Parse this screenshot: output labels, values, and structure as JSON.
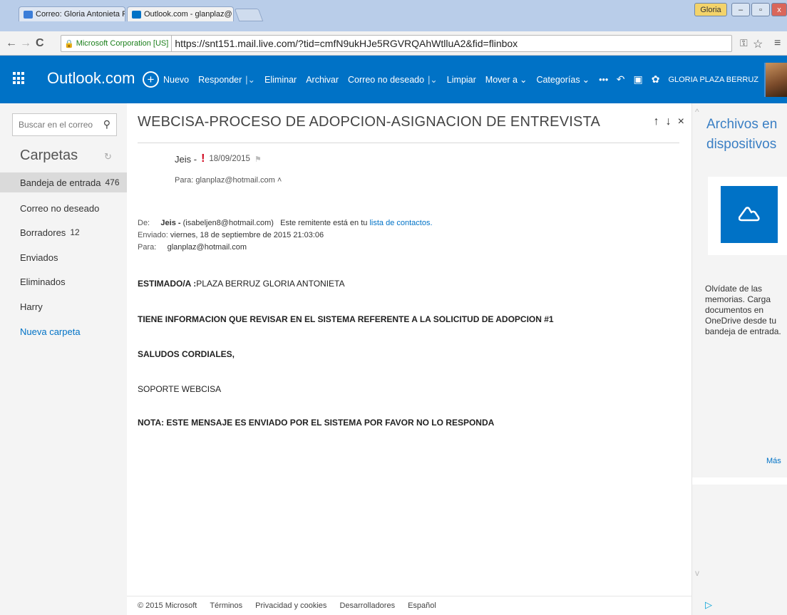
{
  "browser": {
    "tabs": [
      {
        "title": "Correo: Gloria Antonieta P"
      },
      {
        "title": "Outlook.com - glanplaz@"
      }
    ],
    "profile": "Gloria",
    "secure_label": "Microsoft Corporation [US]",
    "url": "https://snt151.mail.live.com/?tid=cmfN9ukHJe5RGVRQAhWtlluA2&fid=flinbox"
  },
  "header": {
    "brand": "Outlook.com",
    "commands": {
      "new": "Nuevo",
      "reply": "Responder",
      "delete": "Eliminar",
      "archive": "Archivar",
      "junk": "Correo no deseado",
      "sweep": "Limpiar",
      "move": "Mover a",
      "categories": "Categorías",
      "more": "•••"
    },
    "user": "GLORIA PLAZA BERRUZ"
  },
  "sidebar": {
    "search_placeholder": "Buscar en el correo",
    "folders_title": "Carpetas",
    "folders": [
      {
        "label": "Bandeja de entrada",
        "count": "476"
      },
      {
        "label": "Correo no deseado",
        "count": ""
      },
      {
        "label": "Borradores",
        "count": "12"
      },
      {
        "label": "Enviados",
        "count": ""
      },
      {
        "label": "Eliminados",
        "count": ""
      },
      {
        "label": "Harry",
        "count": ""
      }
    ],
    "new_folder": "Nueva carpeta"
  },
  "message": {
    "subject": "WEBCISA-PROCESO DE ADOPCION-ASIGNACION DE ENTREVISTA",
    "sender": "Jeis -",
    "date": "18/09/2015",
    "to_line": "Para: glanplaz@hotmail.com",
    "fwd": {
      "de_label": "De:",
      "de_name": "Jeis -",
      "de_email": "(isabeljen8@hotmail.com)",
      "de_note": "Este remitente está en tu",
      "de_link": "lista de contactos.",
      "enviado_label": "Enviado:",
      "enviado_value": "viernes, 18 de septiembre de 2015 21:03:06",
      "para_label": "Para:",
      "para_value": "glanplaz@hotmail.com"
    },
    "body": {
      "greeting_bold": "ESTIMADO/A :",
      "greeting_name": "PLAZA BERRUZ GLORIA ANTONIETA",
      "line1": "TIENE INFORMACION QUE REVISAR EN EL SISTEMA REFERENTE A LA SOLICITUD DE ADOPCION #1",
      "line2": "SALUDOS CORDIALES,",
      "line3": "SOPORTE WEBCISA",
      "line4": "NOTA: ESTE MENSAJE ES ENVIADO POR EL SISTEMA POR FAVOR NO LO RESPONDA"
    }
  },
  "footer": {
    "copyright": "© 2015 Microsoft",
    "terms": "Términos",
    "privacy": "Privacidad y cookies",
    "developers": "Desarrolladores",
    "language": "Español"
  },
  "right_panel": {
    "title": "Archivos en dispositivos",
    "text": "Olvídate de las memorias. Carga documentos en OneDrive desde tu bandeja de entrada.",
    "more": "Más"
  },
  "colors": {
    "accent": "#0072c6",
    "link": "#0072c6",
    "importance": "#d0021b"
  }
}
